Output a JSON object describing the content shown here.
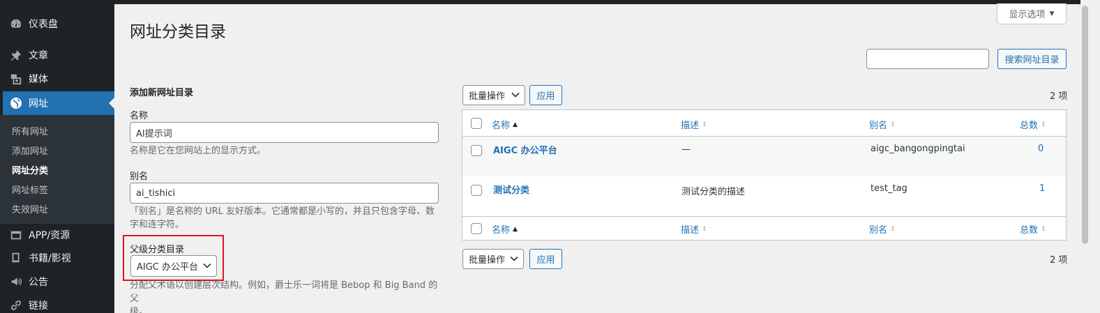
{
  "sidebar": {
    "menu": [
      {
        "label": "仪表盘",
        "icon": "dashboard-icon"
      },
      {
        "label": "文章",
        "icon": "pushpin-icon"
      },
      {
        "label": "媒体",
        "icon": "media-icon"
      },
      {
        "label": "网址",
        "icon": "globe-icon"
      },
      {
        "label": "APP/资源",
        "icon": "app-icon"
      },
      {
        "label": "书籍/影视",
        "icon": "book-icon"
      },
      {
        "label": "公告",
        "icon": "megaphone-icon"
      },
      {
        "label": "链接",
        "icon": "link-icon"
      }
    ],
    "submenu": [
      "所有网址",
      "添加网址",
      "网址分类",
      "网址标签",
      "失效网址"
    ]
  },
  "header": {
    "title": "网址分类目录",
    "screen_options": "显示选项"
  },
  "search": {
    "button": "搜索网址目录",
    "value": ""
  },
  "form": {
    "heading": "添加新网址目录",
    "name_label": "名称",
    "name_value": "AI提示词",
    "name_help": "名称是它在您网站上的显示方式。",
    "slug_label": "别名",
    "slug_value": "ai_tishici",
    "slug_help_1": "「别名」是名称的 URL 友好版本。它通常都是小写的，并且只包含字母、数",
    "slug_help_2": "字和连字符。",
    "parent_label": "父级分类目录",
    "parent_value": "AIGC 办公平台",
    "parent_help_1": "分配父术语以创建层次结构。例如，爵士乐一词将是 Bebop 和 Big Band 的父",
    "parent_help_2": "级。"
  },
  "bulk": {
    "select": "批量操作",
    "apply": "应用",
    "count": "2 项"
  },
  "table": {
    "columns": [
      "名称",
      "描述",
      "别名",
      "总数"
    ],
    "rows": [
      {
        "name": "AIGC 办公平台",
        "description": "—",
        "slug": "aigc_bangongpingtai",
        "count": "0"
      },
      {
        "name": "测试分类",
        "description": "测试分类的描述",
        "slug": "test_tag",
        "count": "1"
      }
    ]
  },
  "colors": {
    "sidebar_bg": "#1d2327",
    "accent": "#2271b1",
    "highlight_border": "#e0131b"
  }
}
